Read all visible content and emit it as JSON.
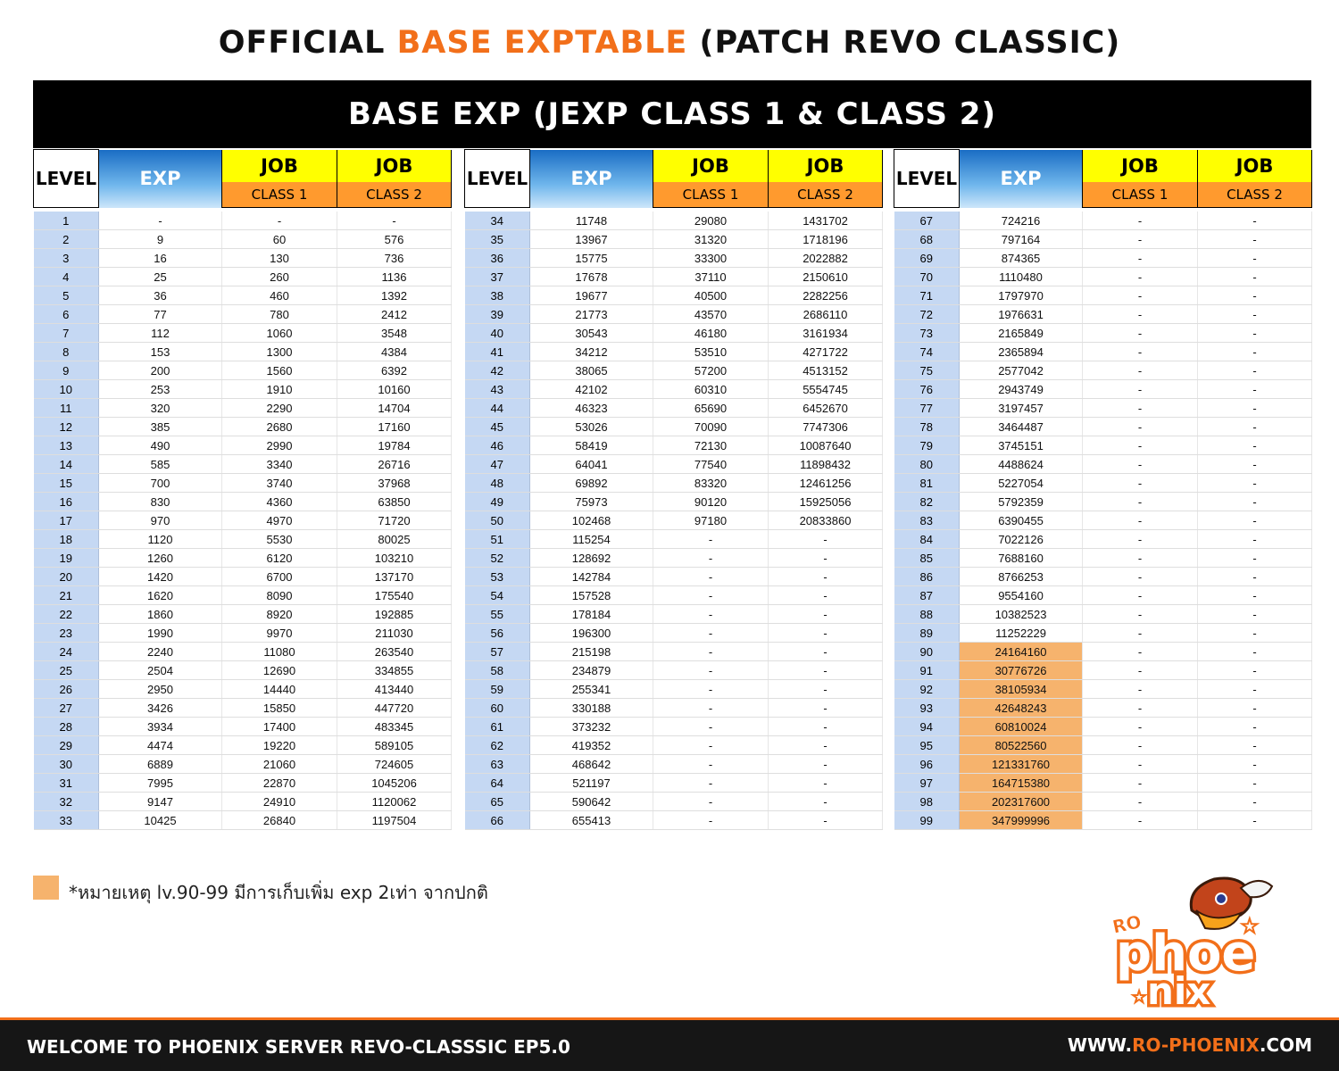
{
  "title": {
    "part1": "OFFICIAL",
    "highlight": "BASE EXPTABLE",
    "part2": "(PATCH REVO CLASSIC)"
  },
  "banner": "BASE EXP (JEXP CLASS 1 & CLASS 2)",
  "headers": {
    "level": "LEVEL",
    "exp": "EXP",
    "job": "JOB",
    "class1": "CLASS 1",
    "class2": "CLASS 2"
  },
  "colors": {
    "accent": "#f26f1a",
    "highlight_cell": "#f6b36d",
    "job_header": "#ffff00",
    "class_header": "#ff9a2e",
    "level_column": "#c5d8f3"
  },
  "rows": [
    [
      "1",
      "-",
      "-",
      "-"
    ],
    [
      "2",
      "9",
      "60",
      "576"
    ],
    [
      "3",
      "16",
      "130",
      "736"
    ],
    [
      "4",
      "25",
      "260",
      "1136"
    ],
    [
      "5",
      "36",
      "460",
      "1392"
    ],
    [
      "6",
      "77",
      "780",
      "2412"
    ],
    [
      "7",
      "112",
      "1060",
      "3548"
    ],
    [
      "8",
      "153",
      "1300",
      "4384"
    ],
    [
      "9",
      "200",
      "1560",
      "6392"
    ],
    [
      "10",
      "253",
      "1910",
      "10160"
    ],
    [
      "11",
      "320",
      "2290",
      "14704"
    ],
    [
      "12",
      "385",
      "2680",
      "17160"
    ],
    [
      "13",
      "490",
      "2990",
      "19784"
    ],
    [
      "14",
      "585",
      "3340",
      "26716"
    ],
    [
      "15",
      "700",
      "3740",
      "37968"
    ],
    [
      "16",
      "830",
      "4360",
      "63850"
    ],
    [
      "17",
      "970",
      "4970",
      "71720"
    ],
    [
      "18",
      "1120",
      "5530",
      "80025"
    ],
    [
      "19",
      "1260",
      "6120",
      "103210"
    ],
    [
      "20",
      "1420",
      "6700",
      "137170"
    ],
    [
      "21",
      "1620",
      "8090",
      "175540"
    ],
    [
      "22",
      "1860",
      "8920",
      "192885"
    ],
    [
      "23",
      "1990",
      "9970",
      "211030"
    ],
    [
      "24",
      "2240",
      "11080",
      "263540"
    ],
    [
      "25",
      "2504",
      "12690",
      "334855"
    ],
    [
      "26",
      "2950",
      "14440",
      "413440"
    ],
    [
      "27",
      "3426",
      "15850",
      "447720"
    ],
    [
      "28",
      "3934",
      "17400",
      "483345"
    ],
    [
      "29",
      "4474",
      "19220",
      "589105"
    ],
    [
      "30",
      "6889",
      "21060",
      "724605"
    ],
    [
      "31",
      "7995",
      "22870",
      "1045206"
    ],
    [
      "32",
      "9147",
      "24910",
      "1120062"
    ],
    [
      "33",
      "10425",
      "26840",
      "1197504"
    ],
    [
      "34",
      "11748",
      "29080",
      "1431702"
    ],
    [
      "35",
      "13967",
      "31320",
      "1718196"
    ],
    [
      "36",
      "15775",
      "33300",
      "2022882"
    ],
    [
      "37",
      "17678",
      "37110",
      "2150610"
    ],
    [
      "38",
      "19677",
      "40500",
      "2282256"
    ],
    [
      "39",
      "21773",
      "43570",
      "2686110"
    ],
    [
      "40",
      "30543",
      "46180",
      "3161934"
    ],
    [
      "41",
      "34212",
      "53510",
      "4271722"
    ],
    [
      "42",
      "38065",
      "57200",
      "4513152"
    ],
    [
      "43",
      "42102",
      "60310",
      "5554745"
    ],
    [
      "44",
      "46323",
      "65690",
      "6452670"
    ],
    [
      "45",
      "53026",
      "70090",
      "7747306"
    ],
    [
      "46",
      "58419",
      "72130",
      "10087640"
    ],
    [
      "47",
      "64041",
      "77540",
      "11898432"
    ],
    [
      "48",
      "69892",
      "83320",
      "12461256"
    ],
    [
      "49",
      "75973",
      "90120",
      "15925056"
    ],
    [
      "50",
      "102468",
      "97180",
      "20833860"
    ],
    [
      "51",
      "115254",
      "-",
      "-"
    ],
    [
      "52",
      "128692",
      "-",
      "-"
    ],
    [
      "53",
      "142784",
      "-",
      "-"
    ],
    [
      "54",
      "157528",
      "-",
      "-"
    ],
    [
      "55",
      "178184",
      "-",
      "-"
    ],
    [
      "56",
      "196300",
      "-",
      "-"
    ],
    [
      "57",
      "215198",
      "-",
      "-"
    ],
    [
      "58",
      "234879",
      "-",
      "-"
    ],
    [
      "59",
      "255341",
      "-",
      "-"
    ],
    [
      "60",
      "330188",
      "-",
      "-"
    ],
    [
      "61",
      "373232",
      "-",
      "-"
    ],
    [
      "62",
      "419352",
      "-",
      "-"
    ],
    [
      "63",
      "468642",
      "-",
      "-"
    ],
    [
      "64",
      "521197",
      "-",
      "-"
    ],
    [
      "65",
      "590642",
      "-",
      "-"
    ],
    [
      "66",
      "655413",
      "-",
      "-"
    ],
    [
      "67",
      "724216",
      "-",
      "-"
    ],
    [
      "68",
      "797164",
      "-",
      "-"
    ],
    [
      "69",
      "874365",
      "-",
      "-"
    ],
    [
      "70",
      "1110480",
      "-",
      "-"
    ],
    [
      "71",
      "1797970",
      "-",
      "-"
    ],
    [
      "72",
      "1976631",
      "-",
      "-"
    ],
    [
      "73",
      "2165849",
      "-",
      "-"
    ],
    [
      "74",
      "2365894",
      "-",
      "-"
    ],
    [
      "75",
      "2577042",
      "-",
      "-"
    ],
    [
      "76",
      "2943749",
      "-",
      "-"
    ],
    [
      "77",
      "3197457",
      "-",
      "-"
    ],
    [
      "78",
      "3464487",
      "-",
      "-"
    ],
    [
      "79",
      "3745151",
      "-",
      "-"
    ],
    [
      "80",
      "4488624",
      "-",
      "-"
    ],
    [
      "81",
      "5227054",
      "-",
      "-"
    ],
    [
      "82",
      "5792359",
      "-",
      "-"
    ],
    [
      "83",
      "6390455",
      "-",
      "-"
    ],
    [
      "84",
      "7022126",
      "-",
      "-"
    ],
    [
      "85",
      "7688160",
      "-",
      "-"
    ],
    [
      "86",
      "8766253",
      "-",
      "-"
    ],
    [
      "87",
      "9554160",
      "-",
      "-"
    ],
    [
      "88",
      "10382523",
      "-",
      "-"
    ],
    [
      "89",
      "11252229",
      "-",
      "-"
    ],
    [
      "90",
      "24164160",
      "-",
      "-"
    ],
    [
      "91",
      "30776726",
      "-",
      "-"
    ],
    [
      "92",
      "38105934",
      "-",
      "-"
    ],
    [
      "93",
      "42648243",
      "-",
      "-"
    ],
    [
      "94",
      "60810024",
      "-",
      "-"
    ],
    [
      "95",
      "80522560",
      "-",
      "-"
    ],
    [
      "96",
      "121331760",
      "-",
      "-"
    ],
    [
      "97",
      "164715380",
      "-",
      "-"
    ],
    [
      "98",
      "202317600",
      "-",
      "-"
    ],
    [
      "99",
      "347999996",
      "-",
      "-"
    ]
  ],
  "highlighted_levels_from": 90,
  "note": "*หมายเหตุ lv.90-99 มีการเก็บเพิ่ม exp 2เท่า จากปกติ",
  "logo": {
    "small": "RO",
    "word_top": "phoe",
    "word_bottom": "nix"
  },
  "footer": {
    "left": "WELCOME TO PHOENIX SERVER REVO-CLASSSIC EP5.0",
    "url_prefix": "WWW.",
    "url_highlight": "RO-PHOENIX",
    "url_suffix": ".COM"
  }
}
